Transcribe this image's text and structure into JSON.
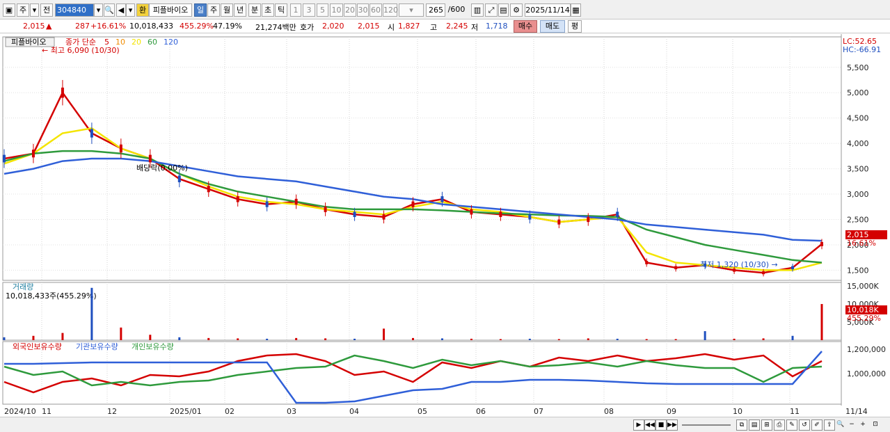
{
  "toolbar": {
    "period_label": "주",
    "prev_label": "전",
    "stock_code": "304840",
    "currency_label": "환",
    "stock_name": "피플바이오",
    "tabs": [
      "일",
      "주",
      "월",
      "년",
      "분",
      "초",
      "틱"
    ],
    "active_tab": "일",
    "intervals": [
      "1",
      "3",
      "5",
      "10",
      "20",
      "30",
      "60",
      "120"
    ],
    "bar_count": "265",
    "bar_max": "/600",
    "date": "2025/11/14"
  },
  "quote": {
    "price": "2,015",
    "change": "287",
    "change_pct": "+16.61%",
    "volume": "10,018,433",
    "volume_pct": "455.29%",
    "turnover": "47.19%",
    "amount": "21,274백만",
    "bid_label": "호가",
    "bid1": "2,020",
    "bid2": "2,015",
    "open_label": "시",
    "open": "1,827",
    "high_label": "고",
    "high": "2,245",
    "low_label": "저",
    "low": "1,718",
    "buy_label": "매수",
    "sell_label": "매도",
    "avg_label": "평"
  },
  "price_panel": {
    "legend": {
      "name": "피플바이오",
      "ma_title": "종가 단순",
      "periods": [
        "5",
        "10",
        "20",
        "60",
        "120"
      ],
      "period_colors": [
        "#d40000",
        "#f08c00",
        "#f4e400",
        "#2e9a3c",
        "#2f5fd8"
      ]
    },
    "lc_label": "LC:52.65",
    "hc_label": "HC:-66.91",
    "high_annotation": "최고 6,090 (10/30)",
    "low_annotation": "최저 1,320 (10/30)",
    "dividend_annotation": "배당락(0.00%)",
    "last_price_tag": "2,015",
    "last_pct_tag": "16.61%",
    "y_ticks": [
      "5,500",
      "5,000",
      "4,500",
      "4,000",
      "3,500",
      "3,000",
      "2,500",
      "2,000",
      "1,500"
    ]
  },
  "volume_panel": {
    "title": "거래량",
    "value_text": "10,018,433주(455.29%)",
    "y_ticks": [
      "15,000K",
      "10,000K",
      "5,000K"
    ],
    "last_tag": "10,018K",
    "last_pct": "455.29%"
  },
  "holding_panel": {
    "legend": [
      "외국인보유수량",
      "기관보유수량",
      "개인보유수량"
    ],
    "legend_colors": [
      "#d40000",
      "#2f5fd8",
      "#2e9a3c"
    ],
    "y_ticks": [
      "1,200,000",
      "1,000,000"
    ]
  },
  "x_axis_labels": [
    "2024/10",
    "11",
    "12",
    "2025/01",
    "02",
    "03",
    "04",
    "05",
    "06",
    "07",
    "08",
    "09",
    "10",
    "11",
    "11/14"
  ],
  "chart_data": {
    "type": "line",
    "title": "피플바이오",
    "x_months": [
      "2024/10",
      "11",
      "12",
      "2025/01",
      "02",
      "03",
      "04",
      "05",
      "06",
      "07",
      "08",
      "09",
      "10",
      "11"
    ],
    "ylim": [
      1300,
      6100
    ],
    "series": [
      {
        "name": "5",
        "color": "#d40000",
        "values": [
          3700,
          3800,
          5000,
          4200,
          3900,
          3700,
          3300,
          3100,
          2900,
          2800,
          2850,
          2700,
          2600,
          2550,
          2800,
          2900,
          2650,
          2600,
          2550,
          2450,
          2500,
          2600,
          1650,
          1550,
          1600,
          1500,
          1450,
          1550,
          2015
        ]
      },
      {
        "name": "20",
        "color": "#f4e400",
        "values": [
          3600,
          3800,
          4200,
          4300,
          3900,
          3700,
          3400,
          3150,
          2950,
          2850,
          2800,
          2700,
          2650,
          2600,
          2750,
          2850,
          2700,
          2650,
          2550,
          2450,
          2500,
          2550,
          1850,
          1650,
          1600,
          1550,
          1500,
          1500,
          1650
        ]
      },
      {
        "name": "60",
        "color": "#2e9a3c",
        "values": [
          3650,
          3800,
          3850,
          3850,
          3800,
          3700,
          3400,
          3200,
          3050,
          2950,
          2850,
          2750,
          2700,
          2700,
          2700,
          2680,
          2650,
          2620,
          2600,
          2580,
          2570,
          2550,
          2300,
          2150,
          2000,
          1900,
          1800,
          1700,
          1650
        ]
      },
      {
        "name": "120",
        "color": "#2f5fd8",
        "values": [
          3400,
          3500,
          3650,
          3700,
          3700,
          3650,
          3550,
          3450,
          3350,
          3300,
          3250,
          3150,
          3050,
          2950,
          2900,
          2800,
          2750,
          2700,
          2650,
          2600,
          2550,
          2500,
          2400,
          2350,
          2300,
          2250,
          2200,
          2100,
          2080
        ]
      }
    ],
    "volume_k": [
      800,
      1200,
      2000,
      14500,
      3500,
      1500,
      800,
      600,
      500,
      400,
      600,
      500,
      400,
      3200,
      600,
      500,
      400,
      300,
      400,
      300,
      500,
      400,
      300,
      300,
      2500,
      400,
      500,
      1200,
      10018
    ]
  }
}
